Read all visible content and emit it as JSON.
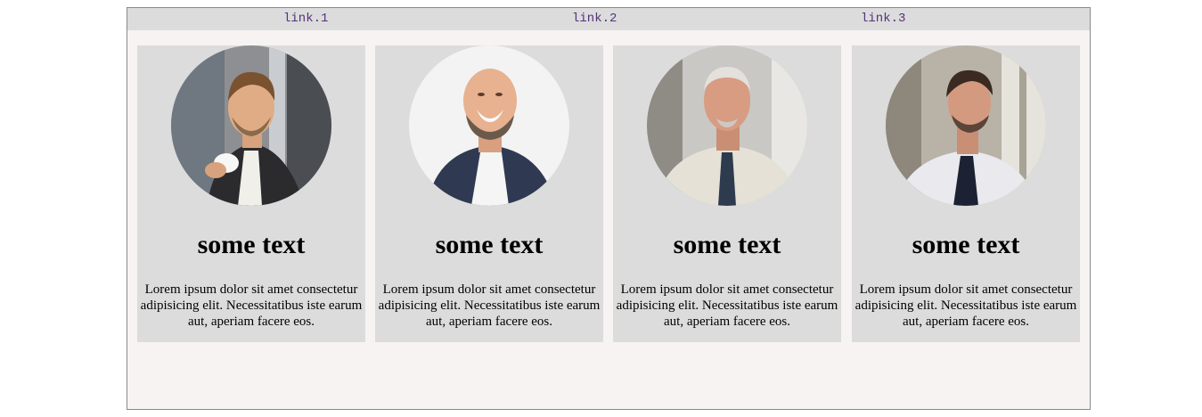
{
  "nav": {
    "links": [
      "link.1",
      "link.2",
      "link.3"
    ]
  },
  "cards": [
    {
      "title": "some text",
      "description": "Lorem ipsum dolor sit amet consectetur adipisicing elit. Necessitatibus iste earum aut, aperiam facere eos.",
      "avatar_icon": "man-holding-coffee-photo"
    },
    {
      "title": "some text",
      "description": "Lorem ipsum dolor sit amet consectetur adipisicing elit. Necessitatibus iste earum aut, aperiam facere eos.",
      "avatar_icon": "bald-man-laughing-photo"
    },
    {
      "title": "some text",
      "description": "Lorem ipsum dolor sit amet consectetur adipisicing elit. Necessitatibus iste earum aut, aperiam facere eos.",
      "avatar_icon": "older-man-with-tie-photo"
    },
    {
      "title": "some text",
      "description": "Lorem ipsum dolor sit amet consectetur adipisicing elit. Necessitatibus iste earum aut, aperiam facere eos.",
      "avatar_icon": "young-man-looking-out-window-photo"
    }
  ],
  "colors": {
    "page_background": "#f6f3f2",
    "nav_background": "#dcdcdc",
    "card_background": "#dcdcdc",
    "link_color": "#55327a"
  }
}
